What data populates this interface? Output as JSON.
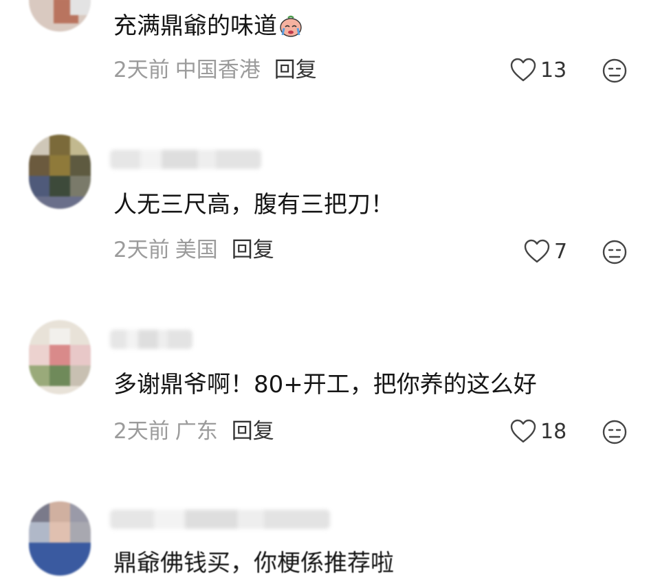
{
  "comments": [
    {
      "username": "",
      "text": "充满鼎爺的味道",
      "emoji": "crying-face-emoji",
      "time": "2天前",
      "location": "中国香港",
      "reply_label": "回复",
      "likes": "13"
    },
    {
      "username": "",
      "text": "人无三尺高，腹有三把刀！",
      "emoji": "",
      "time": "2天前",
      "location": "美国",
      "reply_label": "回复",
      "likes": "7"
    },
    {
      "username": "",
      "text": "多谢鼎爷啊！80+开工，把你养的这么好",
      "emoji": "",
      "time": "2天前",
      "location": "广东",
      "reply_label": "回复",
      "likes": "18"
    },
    {
      "username": "",
      "text": "鼎爺佛钱买，你梗係推荐啦",
      "emoji": "",
      "time": "",
      "location": "",
      "reply_label": "",
      "likes": ""
    }
  ],
  "icons": {
    "like": "heart-outline-icon",
    "dislike": "neutral-face-icon"
  },
  "colors": {
    "text": "#151515",
    "meta": "#9b9b9b",
    "reply": "#333333",
    "icon": "#444444"
  }
}
